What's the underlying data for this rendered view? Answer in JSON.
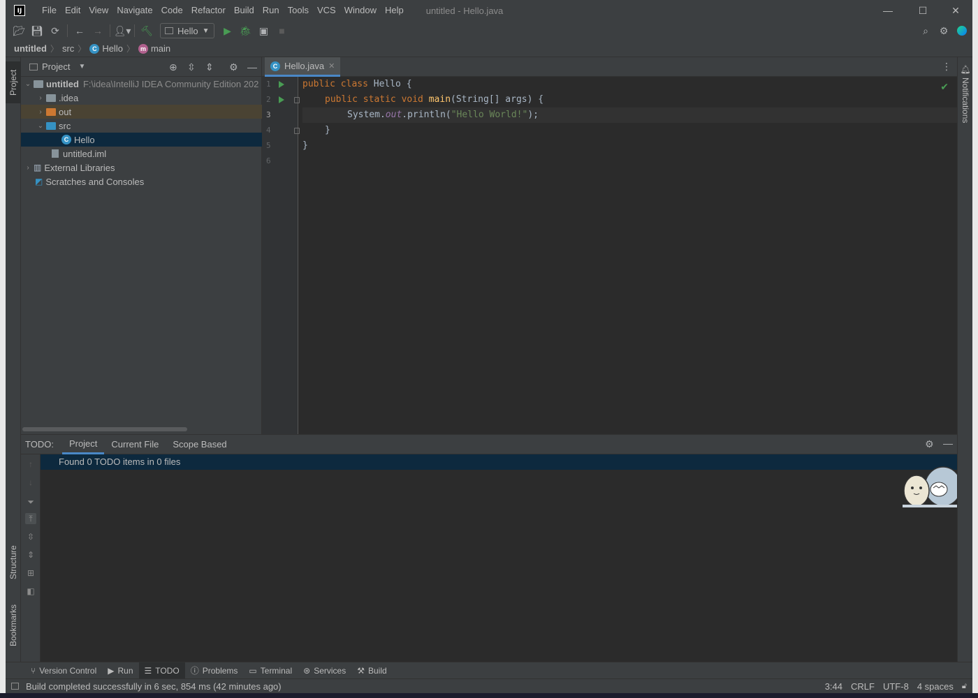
{
  "window": {
    "title": "untitled - Hello.java",
    "logo": "IJ"
  },
  "menu": [
    "File",
    "Edit",
    "View",
    "Navigate",
    "Code",
    "Refactor",
    "Build",
    "Run",
    "Tools",
    "VCS",
    "Window",
    "Help"
  ],
  "toolbar": {
    "run_config": "Hello"
  },
  "breadcrumb": {
    "project": "untitled",
    "folder": "src",
    "class": "Hello",
    "method": "main"
  },
  "left_tabs": {
    "project": "Project",
    "structure": "Structure",
    "bookmarks": "Bookmarks"
  },
  "right_tabs": {
    "notifications": "Notifications"
  },
  "project_panel": {
    "title": "Project",
    "tree": [
      {
        "label": "untitled",
        "path": "F:\\idea\\IntelliJ IDEA Community Edition 202"
      },
      {
        "label": ".idea"
      },
      {
        "label": "out"
      },
      {
        "label": "src"
      },
      {
        "label": "Hello"
      },
      {
        "label": "untitled.iml"
      },
      {
        "label": "External Libraries"
      },
      {
        "label": "Scratches and Consoles"
      }
    ]
  },
  "editor": {
    "tab": "Hello.java",
    "line_numbers": [
      "1",
      "2",
      "3",
      "4",
      "5",
      "6"
    ],
    "code": {
      "l1_kw": "public class ",
      "l1_rest": "Hello {",
      "l2_kw": "public static void ",
      "l2_fn": "main",
      "l2_rest": "(String[] args) {",
      "l3_a": "System.",
      "l3_fld": "out",
      "l3_b": ".println(",
      "l3_str": "\"Hello World!\"",
      "l3_c": ");",
      "l4": "}",
      "l5": "}"
    }
  },
  "todo": {
    "label": "TODO:",
    "tabs": [
      "Project",
      "Current File",
      "Scope Based"
    ],
    "result": "Found 0 TODO items in 0 files"
  },
  "bottom_tabs": [
    "Version Control",
    "Run",
    "TODO",
    "Problems",
    "Terminal",
    "Services",
    "Build"
  ],
  "status": {
    "message": "Build completed successfully in 6 sec, 854 ms (42 minutes ago)",
    "position": "3:44",
    "line_sep": "CRLF",
    "encoding": "UTF-8",
    "indent": "4 spaces"
  },
  "colors": {
    "accent": "#4a88c7",
    "run_green": "#499c54",
    "selection": "#0d293e"
  }
}
